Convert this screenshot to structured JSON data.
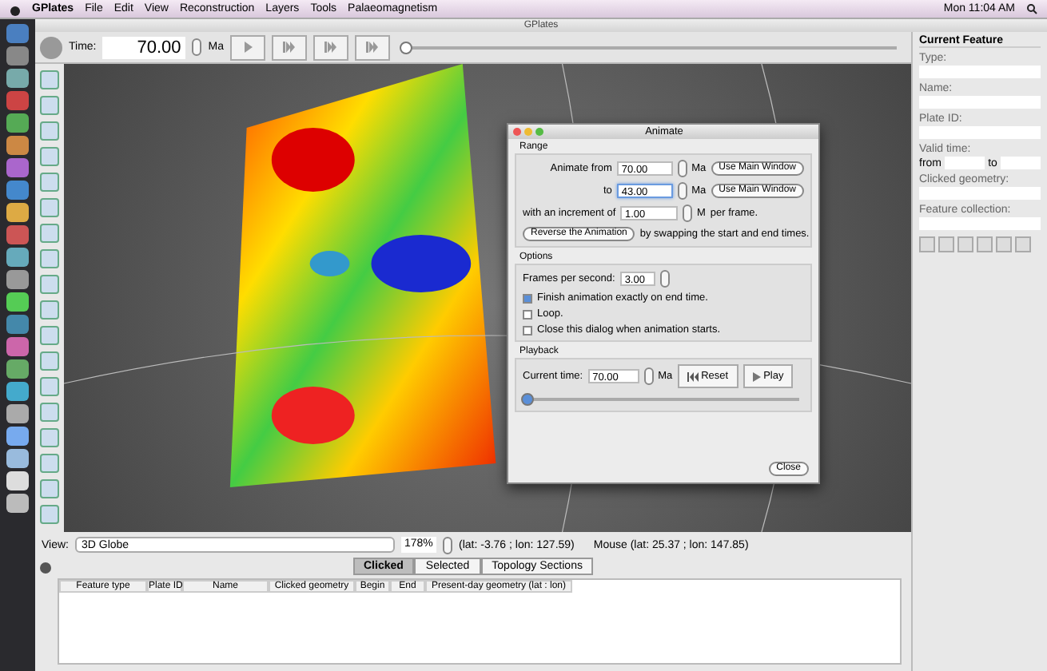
{
  "menubar": {
    "app": "GPlates",
    "items": [
      "File",
      "Edit",
      "View",
      "Reconstruction",
      "Layers",
      "Tools",
      "Palaeomagnetism"
    ],
    "clock": "Mon 11:04 AM"
  },
  "window": {
    "title": "GPlates"
  },
  "toolbar": {
    "time_label": "Time:",
    "time_value": "70.00",
    "unit": "Ma",
    "timeline": {
      "level": 0
    }
  },
  "right_panel": {
    "title": "Current Feature",
    "fields": [
      {
        "label": "Type:"
      },
      {
        "label": "Name:"
      },
      {
        "label": "Plate ID:"
      },
      {
        "label": "Valid time:",
        "kind": "range",
        "from": "from",
        "to": "to"
      },
      {
        "label": "Clicked geometry:"
      },
      {
        "label": "Feature collection:"
      }
    ]
  },
  "dialog": {
    "title": "Animate",
    "range": {
      "title": "Range",
      "rows": [
        {
          "label": "Animate from",
          "value": "70.00",
          "unit": "Ma",
          "button": "Use Main Window",
          "focused": false
        },
        {
          "label": "to",
          "value": "43.00",
          "unit": "Ma",
          "button": "Use Main Window",
          "focused": true
        },
        {
          "label": "with an increment of",
          "value": "1.00",
          "unit": "M",
          "suffix": "per frame.",
          "focused": false
        }
      ],
      "reverse_button": "Reverse the Animation",
      "reverse_note": "by swapping the start and end times."
    },
    "options": {
      "title": "Options",
      "fps_label": "Frames per second:",
      "fps_value": "3.00",
      "checks": [
        {
          "label": "Finish animation exactly on end time.",
          "checked": true
        },
        {
          "label": "Loop.",
          "checked": false
        },
        {
          "label": "Close this dialog when animation starts.",
          "checked": false
        }
      ]
    },
    "playback": {
      "title": "Playback",
      "current_label": "Current time:",
      "current_value": "70.00",
      "unit": "Ma",
      "reset": "Reset",
      "play": "Play",
      "slider": {
        "level": 0
      }
    },
    "close": "Close"
  },
  "view_bar": {
    "label": "View:",
    "view": "3D Globe",
    "zoom": "178%",
    "center": "(lat: -3.76 ; lon: 127.59)",
    "mouse": "Mouse (lat: 25.37 ; lon: 147.85)"
  },
  "bottom": {
    "tabs": [
      {
        "label": "Clicked",
        "selected": true
      },
      {
        "label": "Selected",
        "selected": false
      },
      {
        "label": "Topology Sections",
        "selected": false
      }
    ],
    "columns": [
      "Feature type",
      "Plate ID",
      "Name",
      "Clicked geometry",
      "Begin",
      "End",
      "Present-day geometry (lat : lon)"
    ]
  }
}
